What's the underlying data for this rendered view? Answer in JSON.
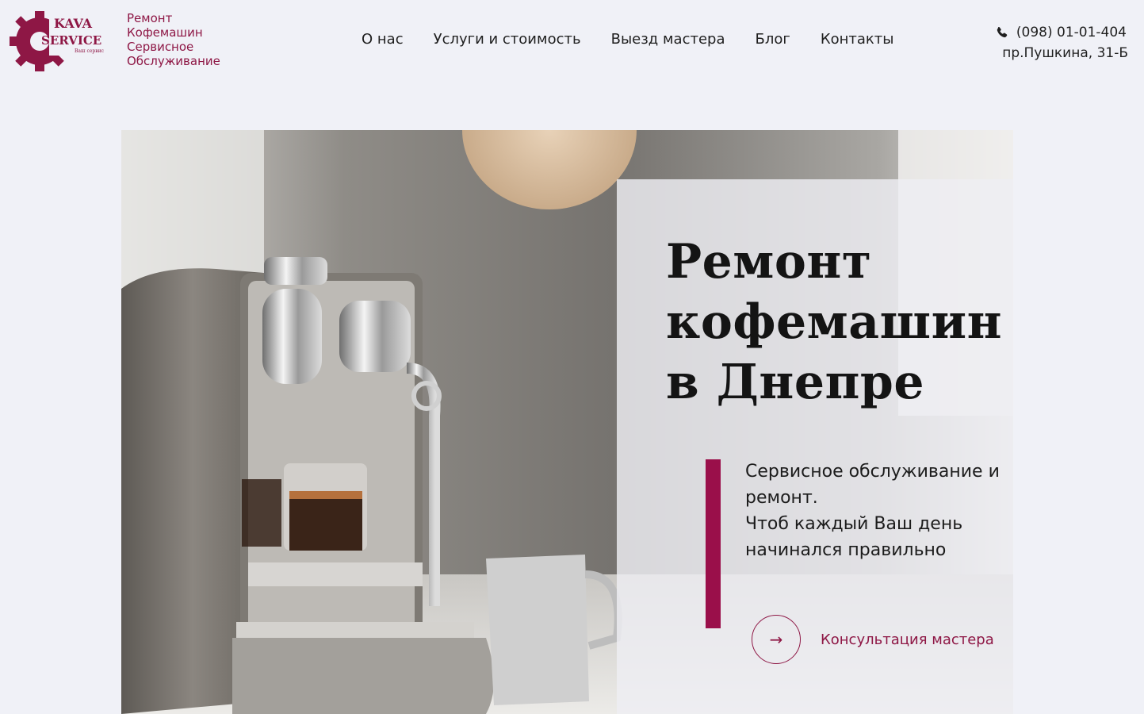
{
  "brand": {
    "logo_top": "KAVA",
    "logo_bottom": "SERVICE",
    "logo_small": "Ваш сервис",
    "tagline": [
      "Ремонт",
      "Кофемашин",
      "Сервисное",
      "Обслуживание"
    ],
    "accent_color": "#8e1745"
  },
  "nav": {
    "items": [
      {
        "label": "О нас"
      },
      {
        "label": "Услуги и стоимость"
      },
      {
        "label": "Выезд мастера"
      },
      {
        "label": "Блог"
      },
      {
        "label": "Контакты"
      }
    ]
  },
  "contact": {
    "phone_icon": "phone-icon",
    "phone": "(098) 01-01-404",
    "address": "пр.Пушкина, 31-Б"
  },
  "hero": {
    "title_lines": [
      "Ремонт",
      "кофемашин",
      "в Днепре"
    ],
    "subtitle_lines": [
      "Сервисное обслуживание и",
      "ремонт.",
      "Чтоб каждый Ваш день",
      "начинался правильно"
    ],
    "cta_icon": "arrow-right-icon",
    "cta_arrow": "→",
    "cta_label": "Консультация мастера",
    "accent_color": "#9a0f4a"
  }
}
